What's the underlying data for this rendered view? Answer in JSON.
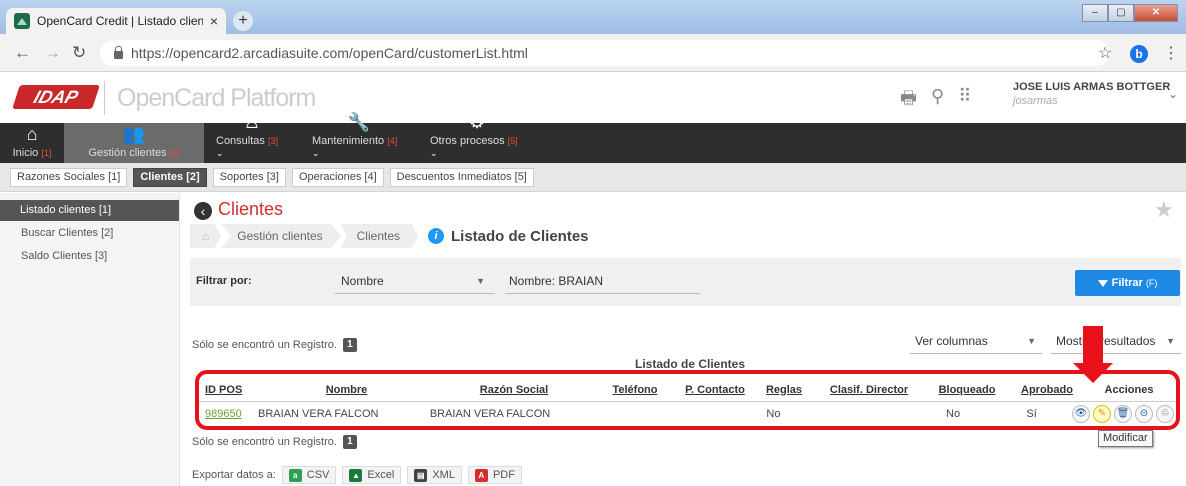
{
  "browser": {
    "tab_title": "OpenCard Credit | Listado cliente",
    "tab_close": "×",
    "new_tab": "+",
    "url": "https://opencard2.arcadiasuite.com/openCard/customerList.html",
    "profile_initial": "b",
    "window_controls": [
      "–",
      "▢",
      "✕"
    ]
  },
  "header": {
    "logo_text": "IDAP",
    "platform_title": "OpenCard Platform",
    "user_name": "JOSE LUIS ARMAS BOTTGER",
    "user_id": "josarmas"
  },
  "main_menu": [
    {
      "label": "Inicio",
      "badge": "[1]",
      "icon": "home-icon",
      "glyph": "⌂",
      "chevron": ""
    },
    {
      "label": "Gestión clientes",
      "badge": "[2]",
      "icon": "users-icon",
      "glyph": "👥",
      "chevron": "",
      "active": true
    },
    {
      "label": "Consultas",
      "badge": "[3]",
      "icon": "query-icon",
      "glyph": "♙",
      "chevron": "⌄"
    },
    {
      "label": "Mantenimiento",
      "badge": "[4]",
      "icon": "wrench-icon",
      "glyph": "🔧",
      "chevron": "⌄"
    },
    {
      "label": "Otros procesos",
      "badge": "[5]",
      "icon": "gear-icon",
      "glyph": "⚙",
      "chevron": "⌄"
    }
  ],
  "sub_menu": [
    "Razones Sociales [1]",
    "Clientes [2]",
    "Soportes [3]",
    "Operaciones [4]",
    "Descuentos Inmediatos [5]"
  ],
  "sidebar": [
    "Listado clientes [1]",
    "Buscar Clientes [2]",
    "Saldo Clientes [3]"
  ],
  "page": {
    "title": "Clientes",
    "breadcrumb": [
      "Gestión clientes",
      "Clientes"
    ],
    "breadcrumb_current": "Listado de Clientes",
    "filter_label": "Filtrar por:",
    "filter_select": "Nombre",
    "filter_value": "Nombre: BRAIAN",
    "filter_button": "Filtrar",
    "filter_shortcut": "(F)",
    "found_text": "Sólo se encontró un Registro.",
    "found_count": "1",
    "columns_select": "Ver columnas",
    "results_select": "Mostrar resultados",
    "table_title": "Listado de Clientes",
    "export_label": "Exportar datos a:",
    "export_buttons": [
      {
        "label": "CSV",
        "icon": "csv-icon",
        "glyph": "a",
        "color": "#2e9e4f"
      },
      {
        "label": "Excel",
        "icon": "excel-icon",
        "glyph": "▲",
        "color": "#1d7a3c"
      },
      {
        "label": "XML",
        "icon": "xml-icon",
        "glyph": "▤",
        "color": "#444444"
      },
      {
        "label": "PDF",
        "icon": "pdf-icon",
        "glyph": "A",
        "color": "#d32f2f"
      }
    ],
    "tooltip": "Modificar"
  },
  "table": {
    "headers": [
      "ID POS",
      "Nombre",
      "Razón Social",
      "Teléfono",
      "P. Contacto",
      "Reglas",
      "Clasif. Director",
      "Bloqueado",
      "Aprobado",
      "Acciones"
    ],
    "rows": [
      {
        "id_pos": "989650",
        "nombre": "BRAIAN VERA FALCON",
        "razon_social": "BRAIAN VERA FALCON",
        "telefono": "",
        "contacto": "",
        "reglas": "No",
        "clasif": "",
        "bloqueado": "No",
        "aprobado": "Sí"
      }
    ],
    "actions": [
      {
        "name": "view-icon",
        "glyph": "👁"
      },
      {
        "name": "pencil-icon",
        "glyph": "✎"
      },
      {
        "name": "trash-icon",
        "glyph": "🗑"
      },
      {
        "name": "hide-icon",
        "glyph": "⊝"
      },
      {
        "name": "approve-icon",
        "glyph": "♲"
      }
    ]
  },
  "colors": {
    "accent": "#d32f2f",
    "highlight": "#e8101a",
    "primary_button": "#1e88e5"
  }
}
